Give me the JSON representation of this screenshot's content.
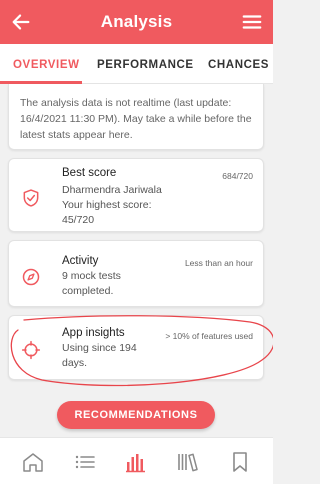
{
  "appbar": {
    "title": "Analysis",
    "back_icon": "back-arrow-icon",
    "menu_icon": "hamburger-menu-icon"
  },
  "tabs": [
    {
      "label": "OVERVIEW",
      "active": true
    },
    {
      "label": "PERFORMANCE",
      "active": false
    },
    {
      "label": "CHANCES",
      "active": false
    }
  ],
  "notice": {
    "text": "The analysis data is not realtime (last update: 16/4/2021 11:30 PM). May take a while before the latest stats appear here."
  },
  "cards": {
    "best_score": {
      "icon": "shield-check-icon",
      "title": "Best score",
      "meta": "684/720",
      "name": "Dharmendra Jariwala",
      "subtitle": "Your highest score: 45/720"
    },
    "activity": {
      "icon": "compass-icon",
      "title": "Activity",
      "meta": "Less than an hour",
      "subtitle": "9 mock tests completed."
    },
    "app_insights": {
      "icon": "target-icon",
      "title": "App insights",
      "meta": "> 10% of features used",
      "subtitle": "Using since 194 days."
    }
  },
  "recommendations_button": {
    "label": "RECOMMENDATIONS"
  },
  "bottom_nav": [
    {
      "icon": "home-icon",
      "active": false
    },
    {
      "icon": "list-icon",
      "active": false
    },
    {
      "icon": "bar-chart-icon",
      "active": true
    },
    {
      "icon": "library-books-icon",
      "active": false
    },
    {
      "icon": "bookmark-icon",
      "active": false
    }
  ],
  "colors": {
    "accent": "#f05a5f",
    "text": "#222222",
    "muted": "#666666",
    "background": "#f1f1f1"
  }
}
